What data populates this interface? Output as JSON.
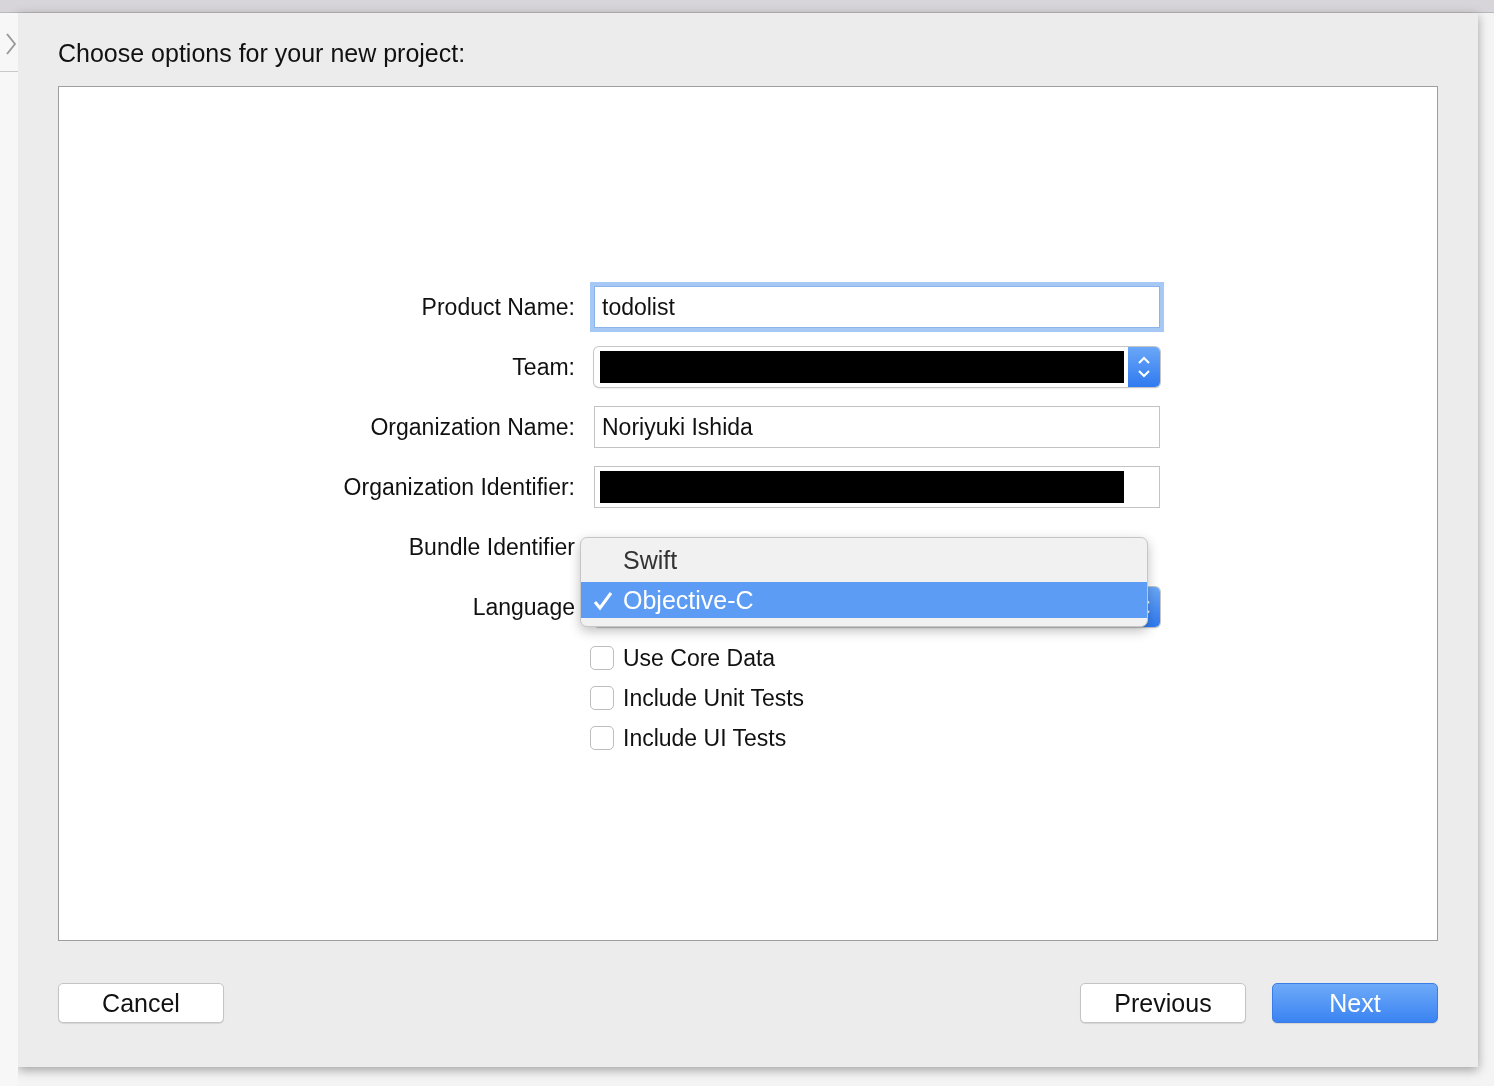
{
  "window": {
    "title": "Choose options for your new project:"
  },
  "form": {
    "fields": [
      {
        "kind": "text",
        "label": "Product Name:",
        "value": "todolist",
        "focused": true
      },
      {
        "kind": "popup",
        "label": "Team:",
        "redacted": true
      },
      {
        "kind": "text",
        "label": "Organization Name:",
        "value": "Noriyuki Ishida",
        "focused": false
      },
      {
        "kind": "text",
        "label": "Organization Identifier:",
        "redacted": true
      },
      {
        "kind": "info",
        "label": "Bundle Identifier"
      },
      {
        "kind": "popup",
        "label": "Language"
      }
    ],
    "options": [
      {
        "label": "Use Core Data",
        "checked": false
      },
      {
        "label": "Include Unit Tests",
        "checked": false
      },
      {
        "label": "Include UI Tests",
        "checked": false
      }
    ]
  },
  "language_menu": {
    "items": [
      {
        "label": "Swift",
        "selected": false
      },
      {
        "label": "Objective-C",
        "selected": true
      }
    ]
  },
  "buttons": [
    {
      "label": "Cancel",
      "kind": "normal"
    },
    {
      "label": "Previous",
      "kind": "normal"
    },
    {
      "label": "Next",
      "kind": "default"
    }
  ]
}
